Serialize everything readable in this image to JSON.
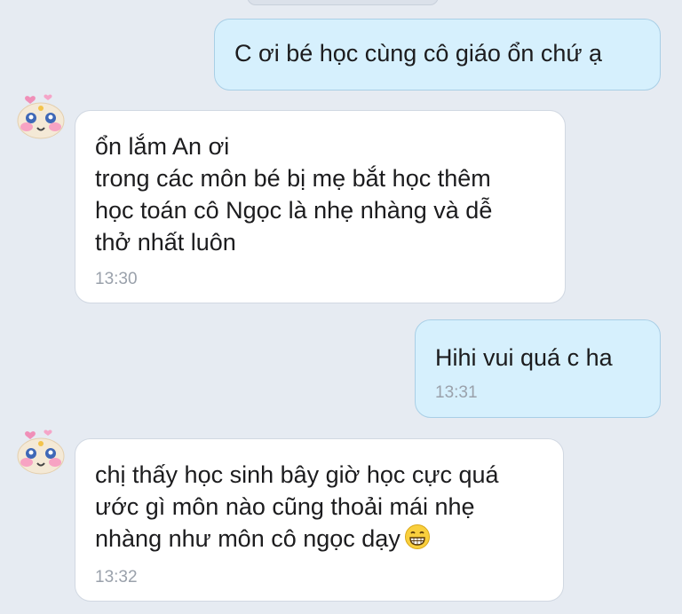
{
  "messages": [
    {
      "side": "out",
      "text": "C ơi bé học cùng cô giáo ổn chứ ạ",
      "time": ""
    },
    {
      "side": "in",
      "text": "ổn lắm An ơi\ntrong các môn bé bị mẹ bắt học thêm\nhọc toán cô Ngọc là nhẹ nhàng và dễ\nthở nhất luôn",
      "time": "13:30"
    },
    {
      "side": "out",
      "text": "Hihi vui quá c ha",
      "time": "13:31"
    },
    {
      "side": "in",
      "text": "chị thấy học sinh bây giờ học cực quá\nước gì môn nào cũng thoải mái nhẹ\nnhàng như môn cô ngọc dạy",
      "time": "13:32",
      "trailing_icon": "grinning-face-emoji"
    }
  ],
  "avatar_icon": "cute-sticker-avatar-icon",
  "colors": {
    "background": "#e6ebf2",
    "outgoing_bubble": "#d6f0fd",
    "incoming_bubble": "#ffffff",
    "time_text": "#9aa1ab"
  }
}
